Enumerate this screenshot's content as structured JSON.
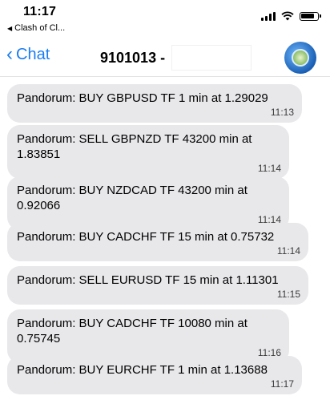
{
  "status": {
    "time": "11:17",
    "back_app": "Clash of Cl..."
  },
  "nav": {
    "back_label": "Chat",
    "title": "9101013 -"
  },
  "messages": [
    {
      "text": "Pandorum: BUY GBPUSD TF 1 min at 1.29029",
      "time": "11:13"
    },
    {
      "text": "Pandorum: SELL GBPNZD TF 43200 min at 1.83851",
      "time": "11:14"
    },
    {
      "text": "Pandorum: BUY NZDCAD TF 43200 min at 0.92066",
      "time": "11:14"
    },
    {
      "text": "Pandorum: BUY CADCHF TF 15 min at 0.75732",
      "time": "11:14"
    },
    {
      "text": "Pandorum: SELL EURUSD TF 15 min at 1.11301",
      "time": "11:15"
    },
    {
      "text": "Pandorum: BUY CADCHF TF 10080 min at 0.75745",
      "time": "11:16"
    },
    {
      "text": "Pandorum: BUY EURCHF TF 1 min at 1.13688",
      "time": "11:17"
    }
  ],
  "icons": {
    "back": "chevron-left-icon",
    "signal": "signal-icon",
    "wifi": "wifi-icon",
    "battery": "battery-icon",
    "avatar": "avatar-icon"
  },
  "colors": {
    "accent": "#1a7df2",
    "bubble": "#e8e8eb"
  }
}
